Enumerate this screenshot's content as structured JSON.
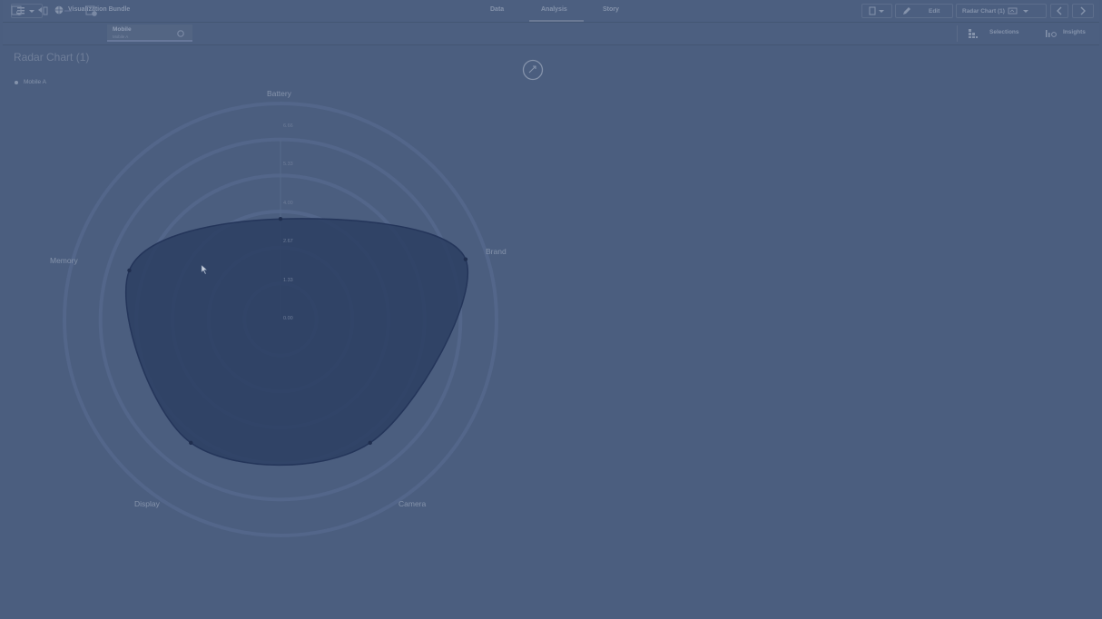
{
  "header": {
    "app_title": "Visualization Bundle",
    "tabs": [
      {
        "label": "Data"
      },
      {
        "label": "Analysis"
      },
      {
        "label": "Story"
      }
    ],
    "edit_label": "Edit",
    "sheet_selector": "Radar Chart (1)"
  },
  "toolbar": {
    "bookmark_title": "Mobile",
    "bookmark_subtitle": "Mobile A",
    "selections_label": "Selections",
    "insights_label": "Insights"
  },
  "chart_data": {
    "type": "radar",
    "title": "Radar Chart (1)",
    "legend": [
      "Mobile A"
    ],
    "axes": [
      "Battery",
      "Brand",
      "Camera",
      "Display",
      "Memory"
    ],
    "tick_labels": [
      "0.00",
      "1.33",
      "2.67",
      "4.00",
      "5.33",
      "6.66"
    ],
    "series": [
      {
        "name": "Mobile A",
        "values": [
          3.1,
          6.0,
          4.7,
          4.7,
          4.9
        ]
      }
    ],
    "max": 6.66,
    "color": "#2c3e62"
  }
}
